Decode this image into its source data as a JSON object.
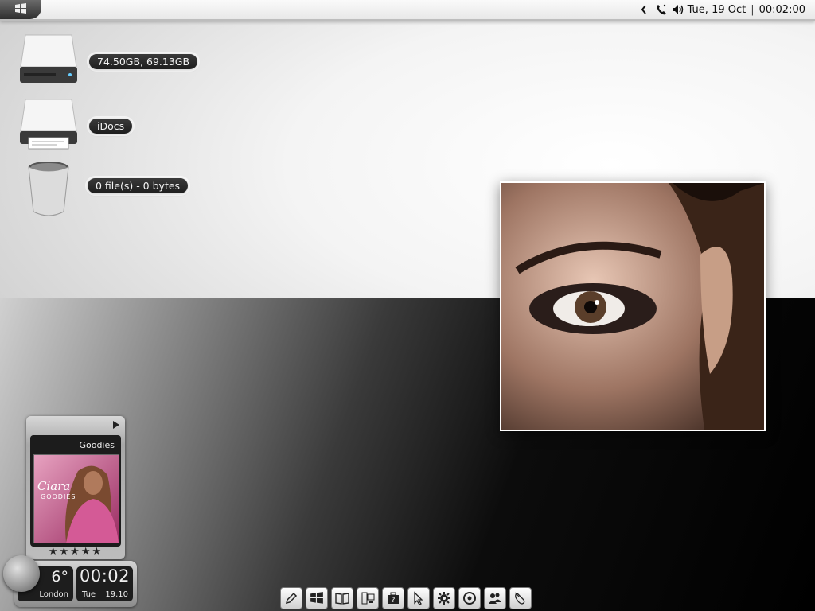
{
  "topbar": {
    "start_icon": "windows-logo-icon",
    "tray_icons": [
      "chevron-left-icon",
      "phone-icon",
      "volume-icon"
    ],
    "date": "Tue, 19 Oct",
    "separator": "|",
    "time": "00:02:00"
  },
  "desktop": {
    "items": [
      {
        "icon": "hard-drive-icon",
        "label": "74.50GB, 69.13GB"
      },
      {
        "icon": "documents-drive-icon",
        "label": "iDocs"
      },
      {
        "icon": "recycle-bin-icon",
        "label": "0 file(s) - 0 bytes"
      }
    ]
  },
  "photo": {
    "subject": "eye-photo"
  },
  "music": {
    "title": "Goodies",
    "cover_text_1": "Ciara",
    "cover_text_2": "GOODIES",
    "rating": "★★★★★"
  },
  "weather": {
    "temp": "6°",
    "city": "London"
  },
  "clock": {
    "time": "00:02",
    "day": "Tue",
    "date": "19.10"
  },
  "dock": {
    "items": [
      "edit-icon",
      "windows-icon",
      "book-icon",
      "computer-icon",
      "help-icon",
      "cursor-icon",
      "gear-icon",
      "disc-icon",
      "users-icon",
      "mouse-icon"
    ]
  },
  "colors": {
    "label_bg": "#2a2a2a",
    "label_text": "#f2f2f2",
    "cover_pink": "#c8508c"
  }
}
